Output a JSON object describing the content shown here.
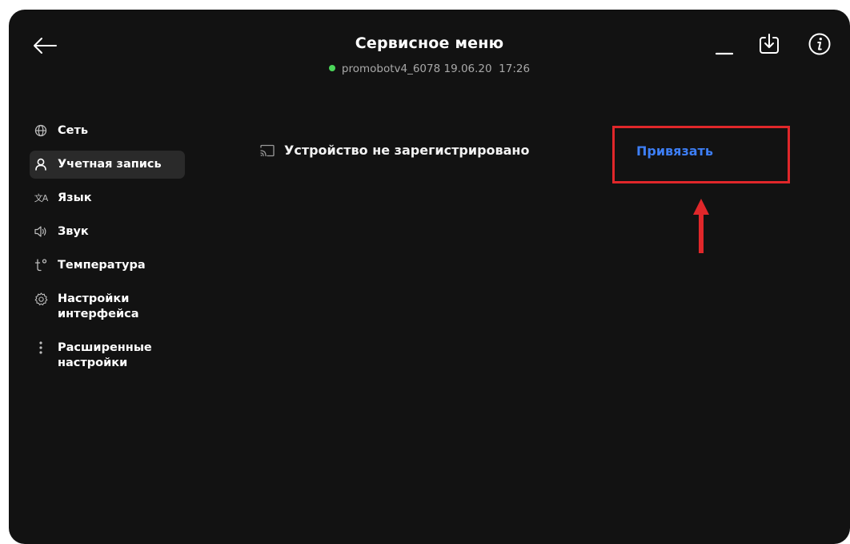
{
  "header": {
    "title": "Сервисное меню",
    "status_text": "promobotv4_6078 19.06.20  17:26",
    "status_color": "#4bd65a",
    "back_icon": "arrow-left-icon",
    "minimize_icon": "minimize-icon",
    "download_icon": "download-icon",
    "info_icon": "info-icon"
  },
  "sidebar": {
    "items": [
      {
        "label": "Сеть",
        "icon": "globe-icon",
        "active": false
      },
      {
        "label": "Учетная запись",
        "icon": "user-icon",
        "active": true
      },
      {
        "label": "Язык",
        "icon": "translate-icon",
        "active": false
      },
      {
        "label": "Звук",
        "icon": "speaker-icon",
        "active": false
      },
      {
        "label": "Температура",
        "icon": "temperature-icon",
        "active": false
      },
      {
        "label": "Настройки интерфейса",
        "icon": "gear-icon",
        "active": false
      },
      {
        "label": "Расширенные настройки",
        "icon": "more-vertical-icon",
        "active": false
      }
    ]
  },
  "content": {
    "device_status": "Устройство не зарегистрировано",
    "device_icon": "cast-icon",
    "bind_label": "Привязать",
    "bind_color": "#3d7ef5"
  },
  "annotation": {
    "color": "#e0272a",
    "arrow_icon": "arrow-up-icon"
  }
}
